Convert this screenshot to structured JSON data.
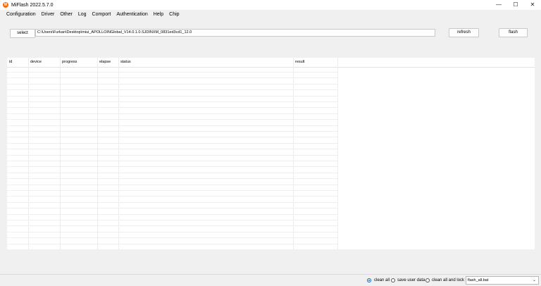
{
  "window": {
    "title": "MiFlash 2022.5.7.0",
    "icon_glyph": "M",
    "controls": {
      "minimize": "—",
      "maximize": "☐",
      "close": "✕"
    }
  },
  "menu": {
    "items": [
      "Configuration",
      "Driver",
      "Other",
      "Log",
      "Comport",
      "Authentication",
      "Help",
      "Chip"
    ]
  },
  "toolbar": {
    "select_label": "select",
    "path_value": "C:\\Users\\Furkan\\Desktop\\miui_APOLLOINGlobal_V14.0.1.0.SJDINXM_0831ed3cd1_12.0",
    "refresh_label": "refresh",
    "flash_label": "flash"
  },
  "grid": {
    "columns": [
      "id",
      "device",
      "progress",
      "elapse",
      "status",
      "result"
    ]
  },
  "footer": {
    "options": [
      {
        "label": "clean all",
        "checked": true
      },
      {
        "label": "save user data",
        "checked": false
      },
      {
        "label": "clean all and lock",
        "checked": false
      }
    ],
    "script_select": {
      "value": "flash_all.bat",
      "arrow": "⌄"
    }
  },
  "colors": {
    "accent": "#0a5fc4",
    "app_icon": "#ff6a00"
  }
}
